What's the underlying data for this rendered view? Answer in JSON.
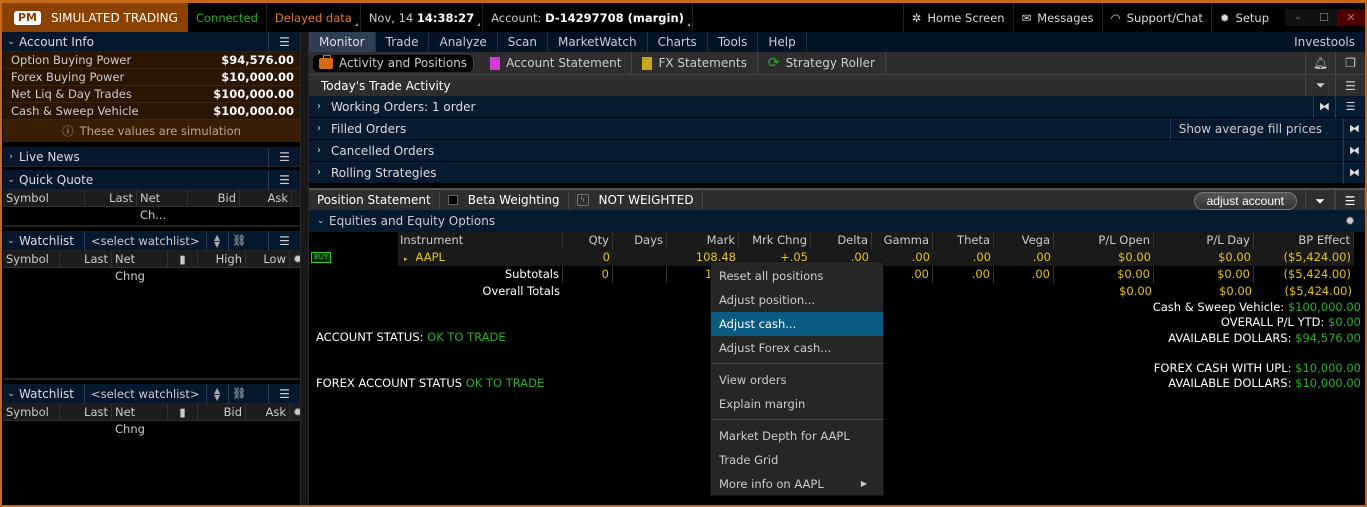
{
  "topbar": {
    "badge": "PM",
    "mode": "SIMULATED TRADING",
    "connection": "Connected",
    "data_status": "Delayed data",
    "date": "Nov, 14",
    "time": "14:38:27",
    "account_label": "Account:",
    "account_value": "D-14297708 (margin)",
    "home_screen": "Home Screen",
    "messages": "Messages",
    "support": "Support/Chat",
    "setup": "Setup",
    "colors": {
      "orange": "#8b4200",
      "green": "#28b028"
    }
  },
  "sidebar": {
    "account_info": {
      "title": "Account Info",
      "rows": [
        {
          "label": "Option Buying Power",
          "value": "$94,576.00"
        },
        {
          "label": "Forex Buying Power",
          "value": "$10,000.00"
        },
        {
          "label": "Net Liq & Day Trades",
          "value": "$100,000.00"
        },
        {
          "label": "Cash & Sweep Vehicle",
          "value": "$100,000.00"
        }
      ],
      "note": "These values are simulation"
    },
    "live_news": {
      "title": "Live News"
    },
    "quick_quote": {
      "title": "Quick Quote",
      "columns": [
        "Symbol",
        "Last",
        "Net Ch...",
        "Bid",
        "Ask"
      ]
    },
    "watchlist1": {
      "title": "Watchlist",
      "select": "<select watchlist>",
      "columns": [
        "Symbol",
        "Last",
        "Net Chng",
        "High",
        "Low"
      ]
    },
    "watchlist2": {
      "title": "Watchlist",
      "select": "<select watchlist>",
      "columns": [
        "Symbol",
        "Last",
        "Net Chng",
        "Bid",
        "Ask"
      ]
    }
  },
  "nav": {
    "tabs": [
      "Monitor",
      "Trade",
      "Analyze",
      "Scan",
      "MarketWatch",
      "Charts",
      "Tools",
      "Help"
    ],
    "active": "Monitor",
    "right": "Investools"
  },
  "subtabs": [
    "Activity and Positions",
    "Account Statement",
    "FX Statements",
    "Strategy Roller"
  ],
  "trade_activity": {
    "title": "Today's Trade Activity",
    "rows": [
      "Working Orders: 1 order",
      "Filled Orders",
      "Cancelled Orders",
      "Rolling Strategies"
    ],
    "avg_fill": "Show average fill prices"
  },
  "position_statement": {
    "title": "Position Statement",
    "beta_label": "Beta Weighting",
    "beta_value": "NOT WEIGHTED",
    "adjust_button": "adjust account",
    "group": "Equities and Equity Options",
    "columns": [
      "Instrument",
      "Qty",
      "Days",
      "Mark",
      "Mrk Chng",
      "Delta",
      "Gamma",
      "Theta",
      "Vega",
      "P/L Open",
      "P/L Day",
      "BP Effect"
    ],
    "position": {
      "badge": "BUY",
      "instrument": "AAPL",
      "qty": "0",
      "days": "",
      "mark": "108.48",
      "mrk_chng": "+.05",
      "delta": ".00",
      "gamma": ".00",
      "theta": ".00",
      "vega": ".00",
      "pl_open": "$0.00",
      "pl_day": "$0.00",
      "bp_effect": "($5,424.00)"
    },
    "subtotals": {
      "label": "Subtotals",
      "qty": "0",
      "mark": "1",
      "gamma": ".00",
      "theta": ".00",
      "vega": ".00",
      "pl_open": "$0.00",
      "pl_day": "$0.00",
      "bp_effect": "($5,424.00)"
    },
    "overall": {
      "label": "Overall Totals",
      "pl_open": "$0.00",
      "pl_day": "$0.00",
      "bp_effect": "($5,424.00)"
    }
  },
  "summary": [
    {
      "label": "Cash & Sweep Vehicle:",
      "value": "$100,000.00"
    },
    {
      "label": "OVERALL P/L YTD:",
      "value": "$0.00"
    },
    {
      "label": "AVAILABLE DOLLARS:",
      "value": "$94,576.00"
    },
    {
      "label": "FOREX CASH WITH UPL:",
      "value": "$10,000.00"
    },
    {
      "label": "AVAILABLE DOLLARS:",
      "value": "$10,000.00"
    }
  ],
  "status": {
    "account_label": "ACCOUNT STATUS:",
    "account_value": "OK TO TRADE",
    "forex_label": "FOREX ACCOUNT STATUS",
    "forex_value": "OK TO TRADE"
  },
  "context_menu": {
    "items": [
      "Reset all positions",
      "Adjust position...",
      "Adjust cash...",
      "Adjust Forex cash...",
      "View orders",
      "Explain margin",
      "Market Depth for AAPL",
      "Trade Grid",
      "More info on AAPL"
    ],
    "highlighted": "Adjust cash..."
  }
}
